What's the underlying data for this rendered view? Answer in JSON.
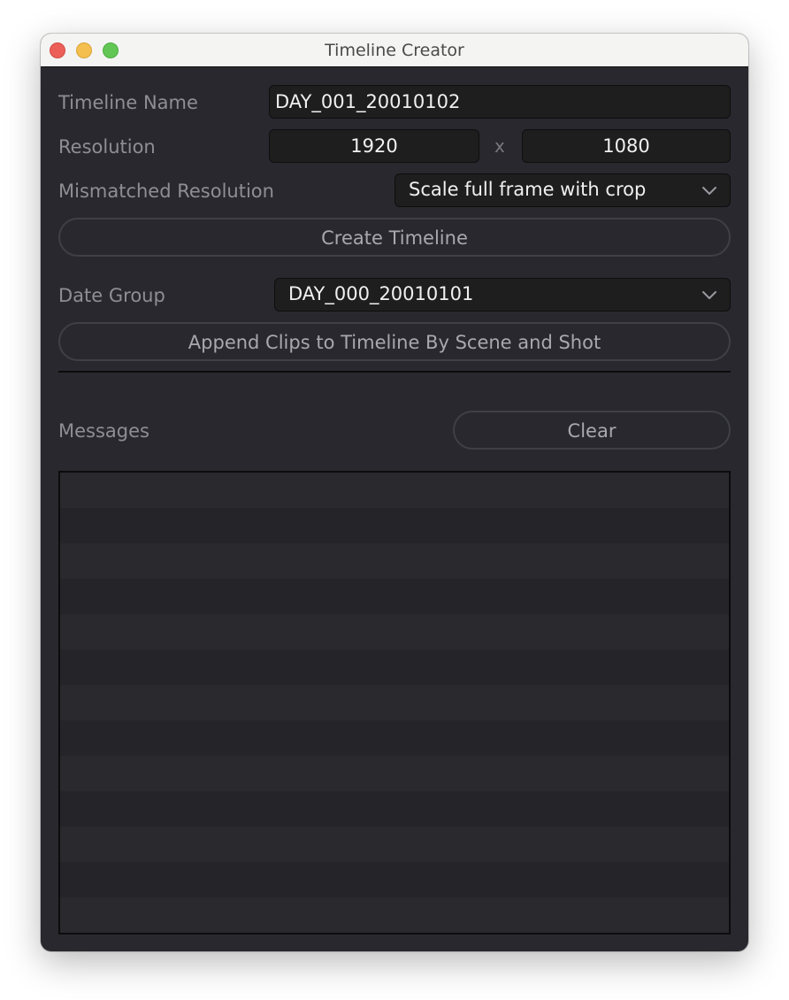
{
  "window": {
    "title": "Timeline Creator",
    "controls": [
      "close",
      "minimize",
      "maximize"
    ]
  },
  "form": {
    "timeline_name_label": "Timeline Name",
    "timeline_name_value": "DAY_001_20010102",
    "resolution_label": "Resolution",
    "resolution_width": "1920",
    "resolution_separator": "x",
    "resolution_height": "1080",
    "mismatched_label": "Mismatched Resolution",
    "mismatched_value": "Scale full frame with crop",
    "create_button": "Create Timeline",
    "date_group_label": "Date Group",
    "date_group_value": "DAY_000_20010101",
    "append_button": "Append Clips to Timeline By Scene and Shot"
  },
  "messages": {
    "label": "Messages",
    "clear_button": "Clear",
    "items": []
  },
  "colors": {
    "window_bg": "#28282e",
    "field_bg": "#1e1e1f",
    "label_text": "#8e8e93",
    "button_border": "#3f4045",
    "close": "#ec5f58",
    "minimize": "#f4bf4f",
    "maximize": "#62c655"
  }
}
